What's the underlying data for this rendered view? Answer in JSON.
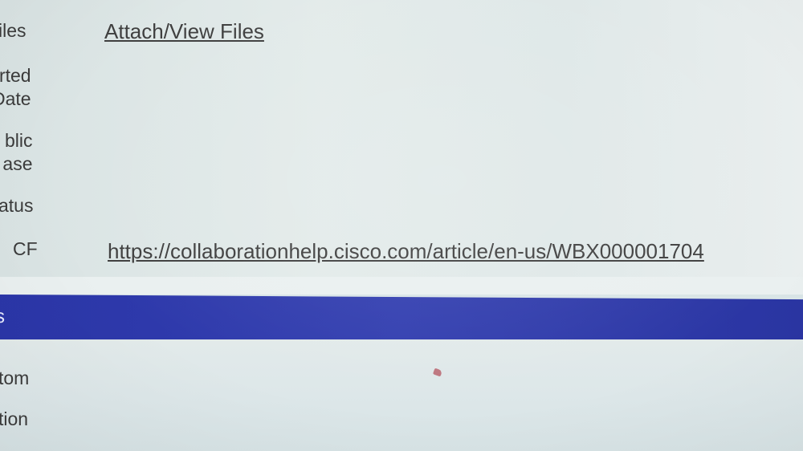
{
  "form": {
    "rows": [
      {
        "label_lines": [
          "iles"
        ],
        "value": "Attach/View Files"
      },
      {
        "label_lines": [
          "rted",
          "Date"
        ],
        "value": ""
      },
      {
        "label_lines": [
          "blic",
          "ase"
        ],
        "value": ""
      },
      {
        "label_lines": [
          "atus"
        ],
        "value": ""
      },
      {
        "label_lines": [
          "CF"
        ],
        "value": "https://collaborationhelp.cisco.com/article/en-us/WBX000001704"
      }
    ]
  },
  "section_bar": {
    "label": "s",
    "color": "#2f3aac"
  },
  "lower": {
    "rows": [
      {
        "label": "tom"
      },
      {
        "label": "tion"
      }
    ]
  }
}
